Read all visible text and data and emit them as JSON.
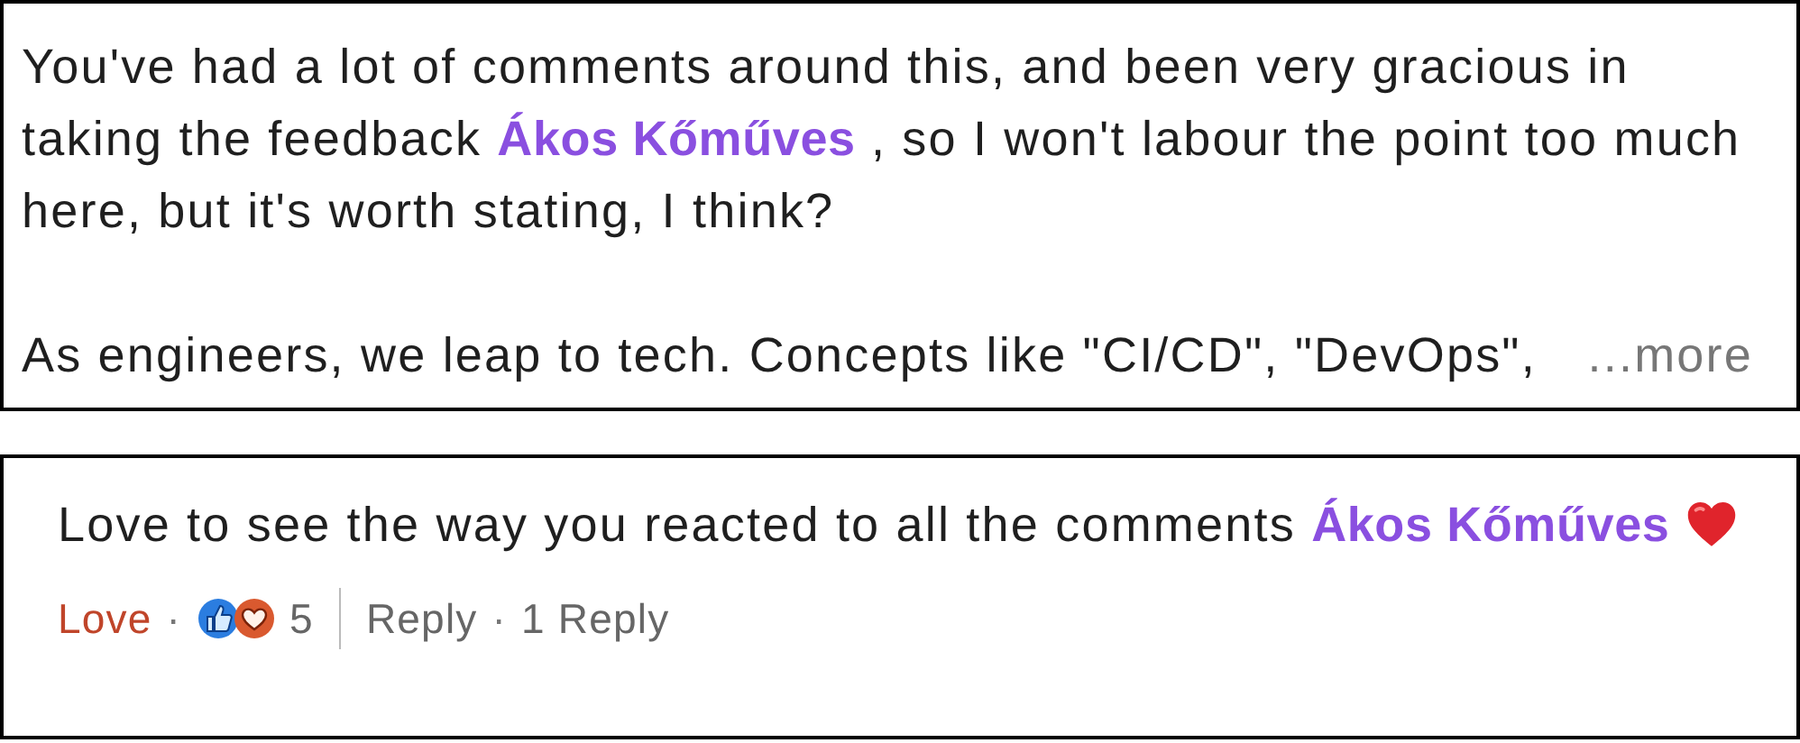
{
  "comments": [
    {
      "paragraphs": [
        [
          {
            "kind": "text",
            "text": "You've had a lot of comments around this, and been very gracious in taking the feedback "
          },
          {
            "kind": "mention",
            "text": "Ákos Kőműves"
          },
          {
            "kind": "text",
            "text": " , so I won't labour the point too much here, but it's worth stating, I think?"
          }
        ],
        [
          {
            "kind": "text",
            "text": "As engineers, we leap to tech. Concepts like \"CI/CD\", \"DevOps\","
          }
        ]
      ],
      "more": "...more"
    },
    {
      "paragraphs": [
        [
          {
            "kind": "text",
            "text": "Love to see the way you reacted to all the comments "
          },
          {
            "kind": "mention",
            "text": "Ákos Kőműves"
          },
          {
            "kind": "heart_emoji"
          }
        ]
      ],
      "actions": {
        "reaction": "Love",
        "separator": "·",
        "reaction_count": "5",
        "reply": "Reply",
        "replies": "1 Reply"
      }
    }
  ]
}
